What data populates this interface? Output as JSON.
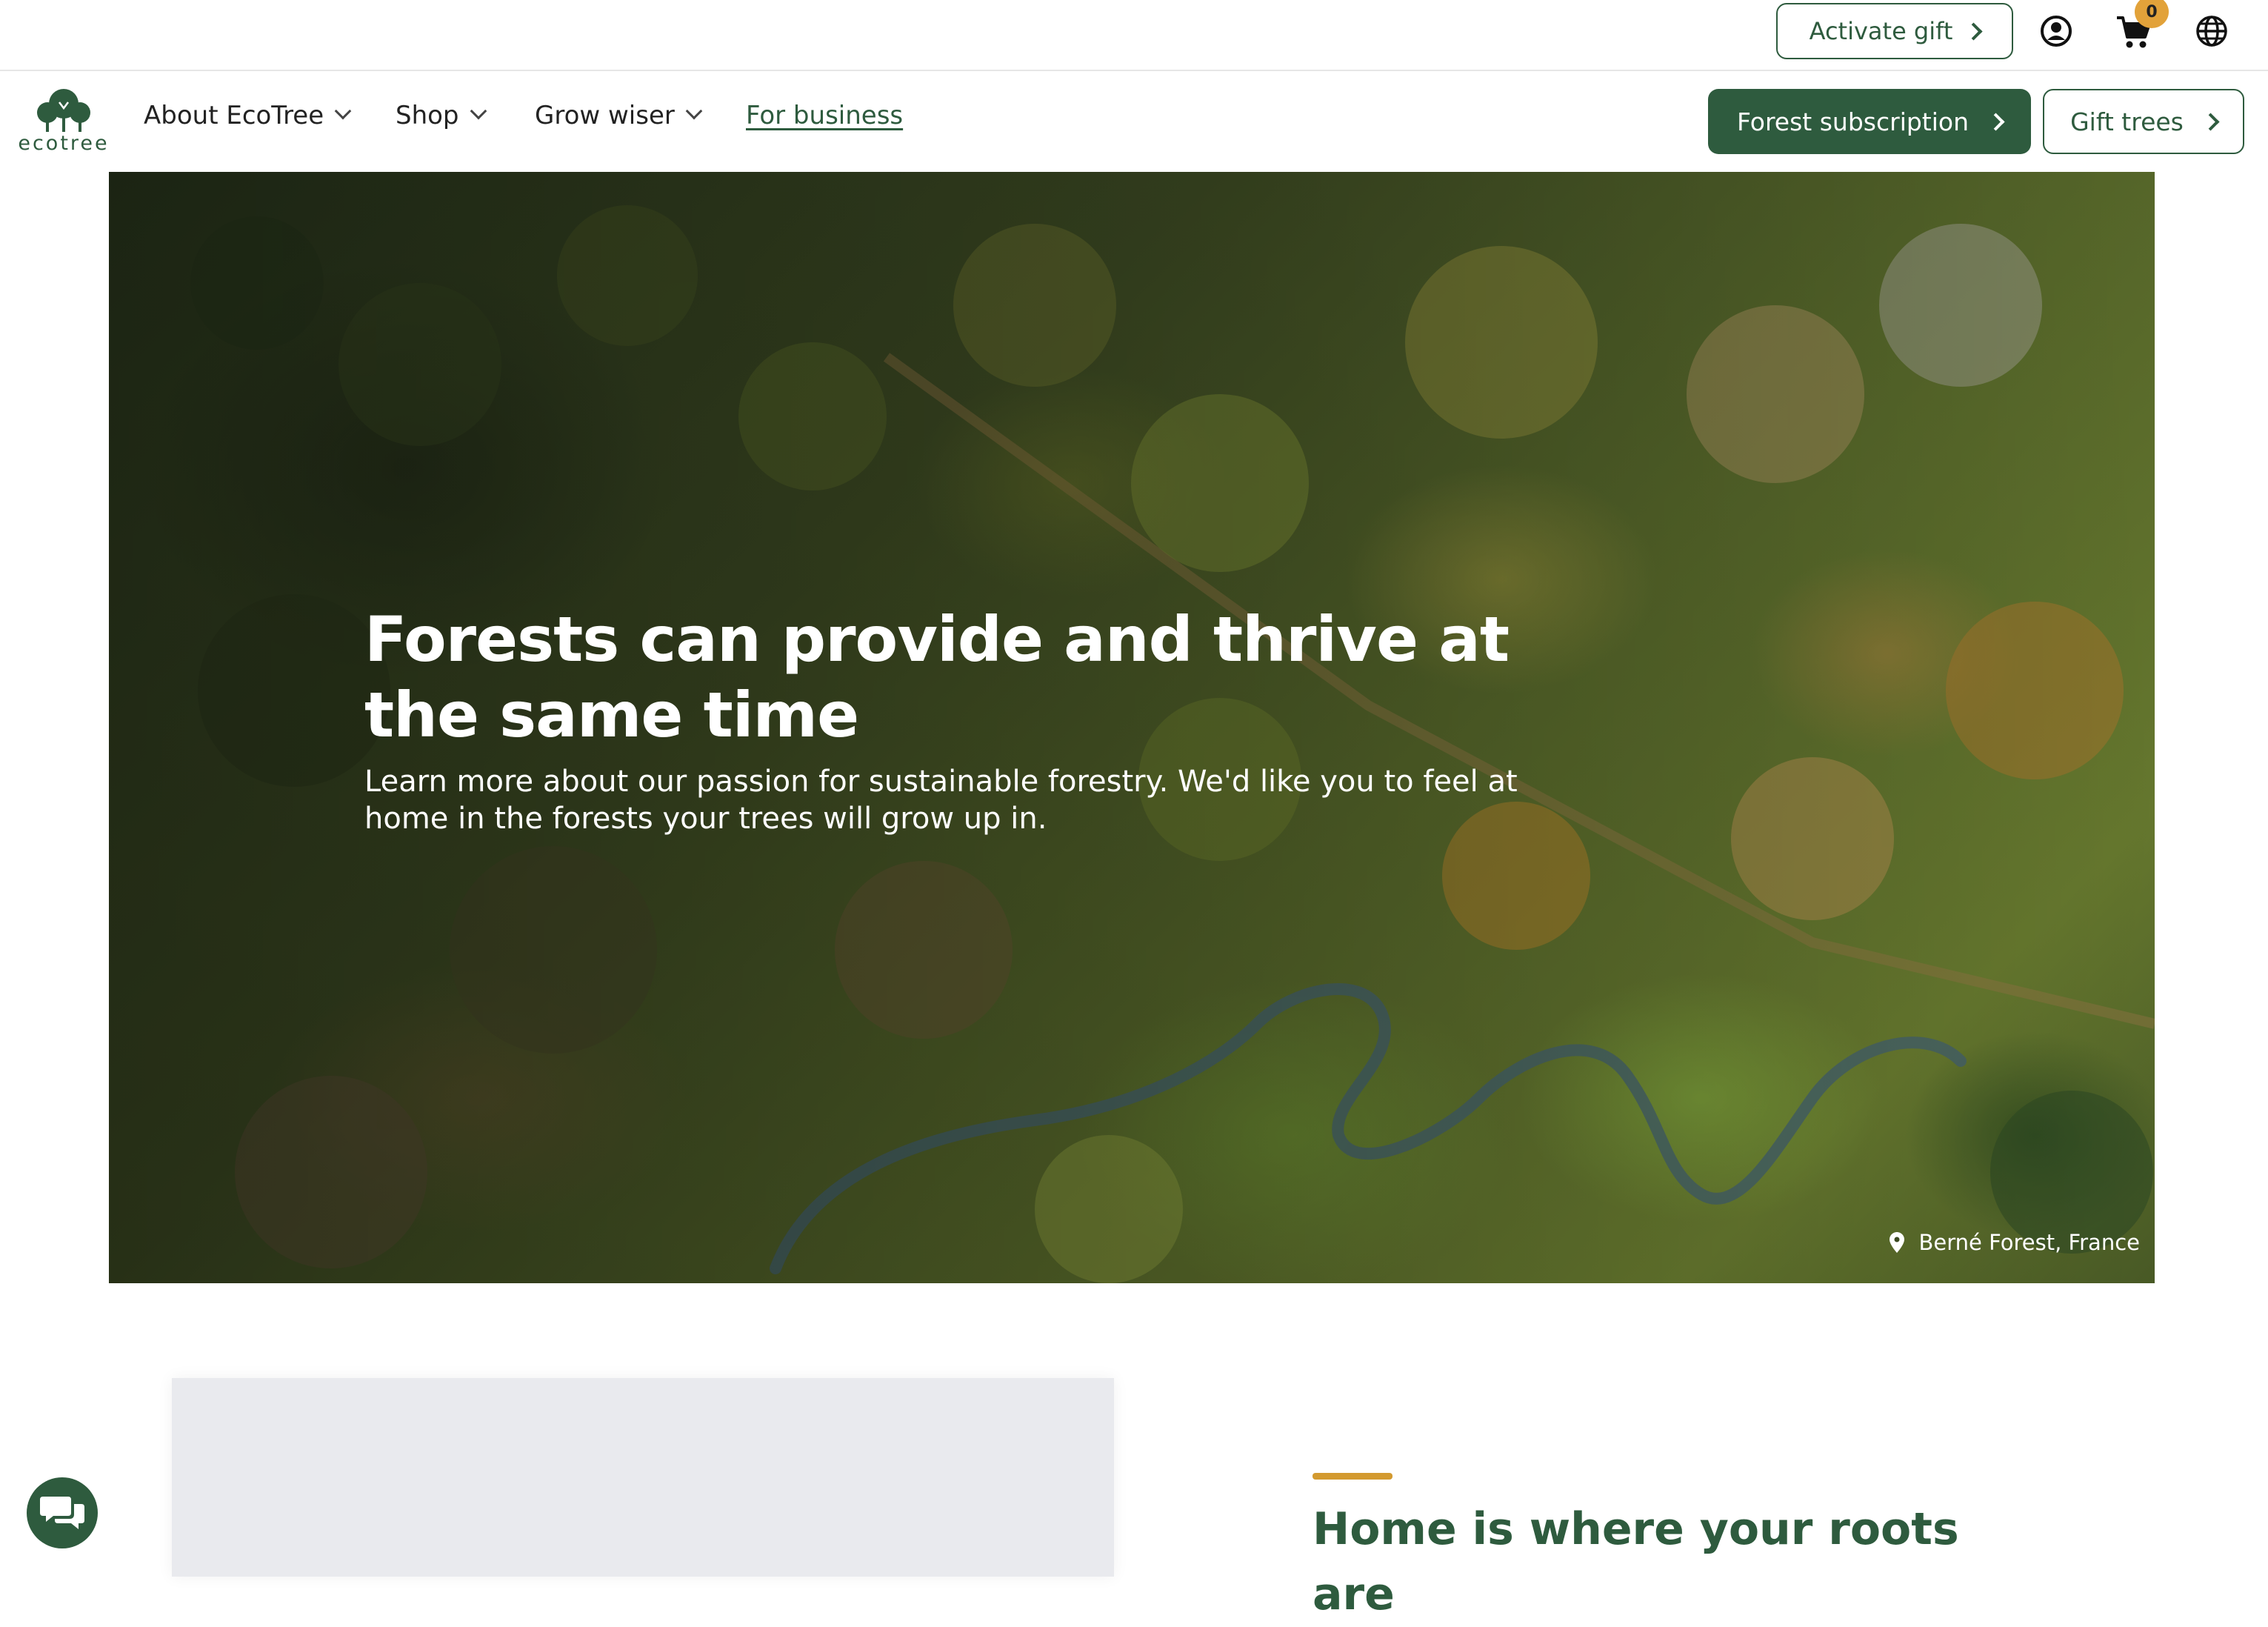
{
  "topbar": {
    "activate_gift_label": "Activate gift",
    "cart_count": "0",
    "icons": [
      "account-icon",
      "cart-icon",
      "globe-icon"
    ]
  },
  "nav": {
    "logo_text": "ecotree",
    "items": [
      {
        "label": "About EcoTree"
      },
      {
        "label": "Shop"
      },
      {
        "label": "Grow wiser"
      },
      {
        "label": "For business"
      }
    ],
    "forest_subscription_label": "Forest subscription",
    "gift_trees_label": "Gift trees"
  },
  "hero": {
    "title": "Forests can provide and thrive at the same time",
    "subtitle": "Learn more about our passion for sustainable forestry. We'd like you to feel at home in the forests your trees will grow up in.",
    "location": "Berné Forest, France"
  },
  "section": {
    "title": "Home is where your roots are"
  },
  "colors": {
    "brand_green": "#2e5b3e",
    "accent_orange": "#d39a2f",
    "badge_orange": "#e2a23a"
  }
}
